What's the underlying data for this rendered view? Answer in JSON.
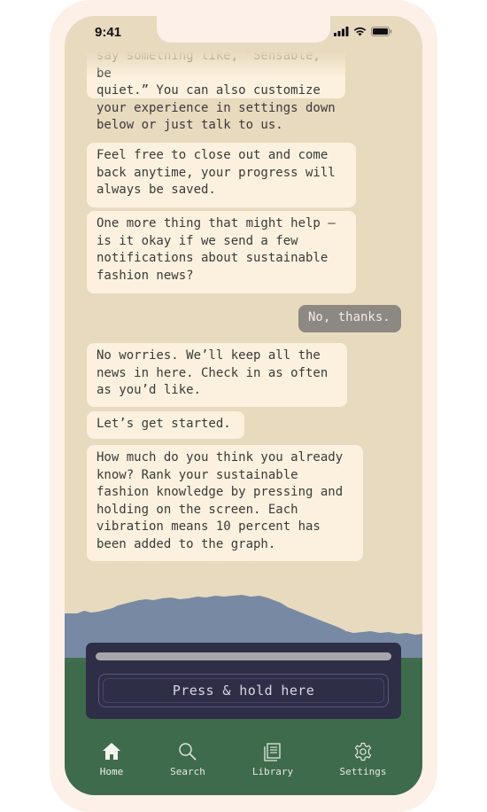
{
  "status_bar": {
    "time": "9:41"
  },
  "messages": [
    {
      "from": "app",
      "text": "say something like, “Sensable, be\nquiet.” You can also customize\nyour experience in settings down\nbelow or just talk to us."
    },
    {
      "from": "app",
      "text": "Feel free to close out and come\nback anytime, your progress will\nalways be saved."
    },
    {
      "from": "app",
      "text": "One more thing that might help –\nis it okay if we send a few\nnotifications about sustainable\nfashion news?"
    },
    {
      "from": "user",
      "text": "No, thanks."
    },
    {
      "from": "app",
      "text": "No worries. We’ll keep all the\nnews in here. Check in as often\nas you’d like."
    },
    {
      "from": "app",
      "text": "Let’s get started."
    },
    {
      "from": "app",
      "text": "How much do you think you already\nknow? Rank your sustainable\nfashion knowledge by pressing and\nholding on the screen. Each\nvibration means 10 percent has\nbeen added to the graph."
    }
  ],
  "press_panel": {
    "progress": 0,
    "button_label": "Press & hold here"
  },
  "tabs": [
    {
      "label": "Home",
      "icon": "home-icon",
      "active": true
    },
    {
      "label": "Search",
      "icon": "search-icon",
      "active": false
    },
    {
      "label": "Library",
      "icon": "library-icon",
      "active": false
    },
    {
      "label": "Settings",
      "icon": "gear-icon",
      "active": false
    }
  ],
  "colors": {
    "background": "#e8dabf",
    "bubble_app": "#fbf1de",
    "bubble_user": "#8c8882",
    "sky_blue": "#7889a3",
    "grass_green": "#3f6b4d",
    "panel": "#2f2e47"
  }
}
